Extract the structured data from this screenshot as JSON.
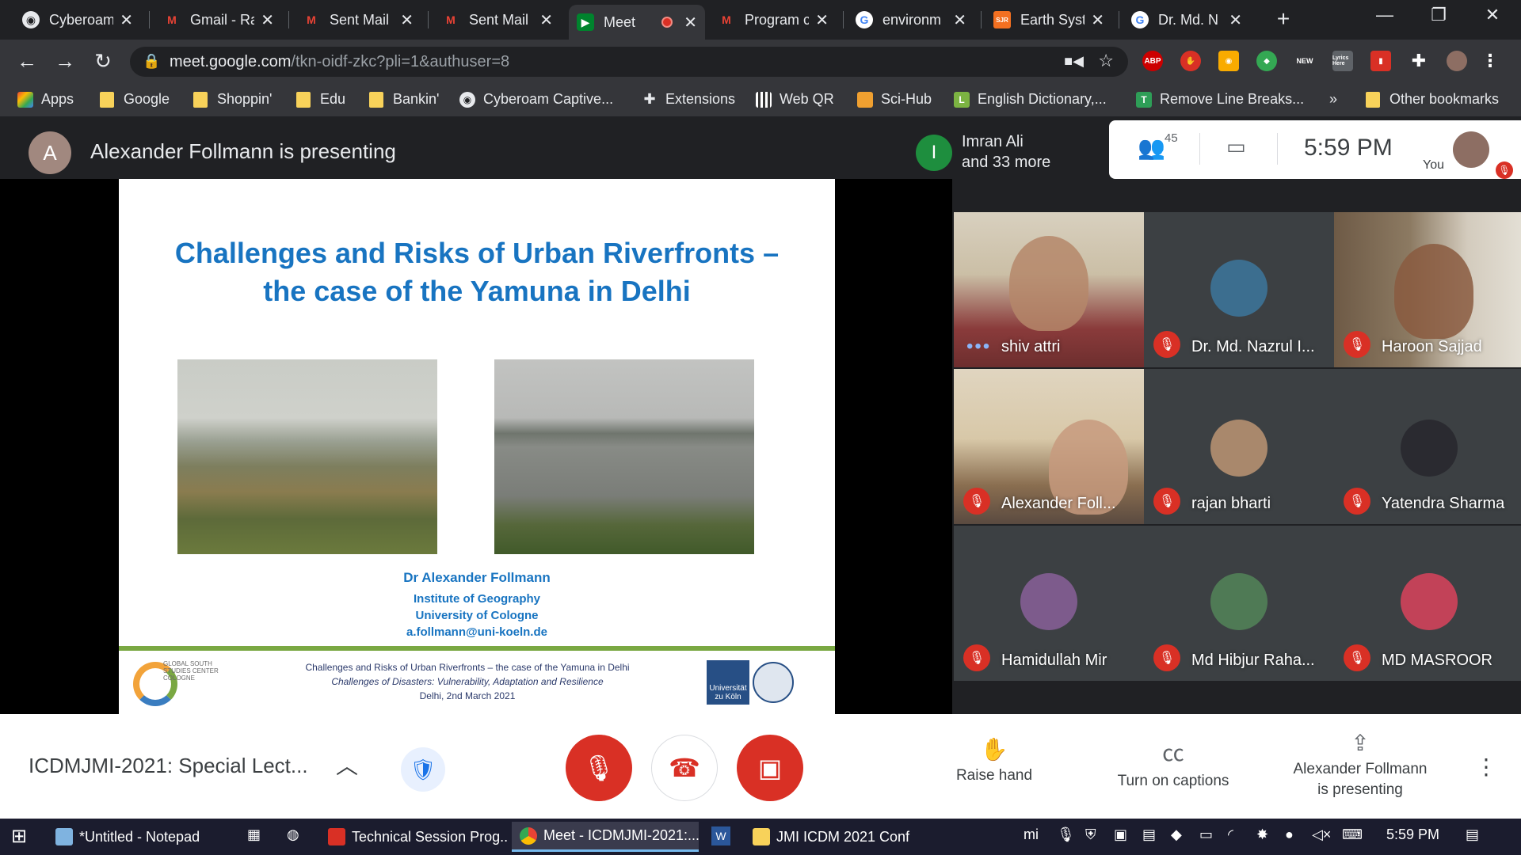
{
  "browser": {
    "tabs": [
      {
        "title": "Cyberoam",
        "icon": "globe-icon",
        "active": false
      },
      {
        "title": "Gmail - Ra",
        "icon": "gmail-icon",
        "active": false
      },
      {
        "title": "Sent Mail",
        "icon": "gmail-icon",
        "active": false
      },
      {
        "title": "Sent Mail",
        "icon": "gmail-icon",
        "active": false
      },
      {
        "title": "Meet",
        "icon": "meet-icon",
        "active": true
      },
      {
        "title": "Program c",
        "icon": "gmail-icon",
        "active": false
      },
      {
        "title": "environm",
        "icon": "google-icon",
        "active": false
      },
      {
        "title": "Earth Syst",
        "icon": "sjr-icon",
        "active": false
      },
      {
        "title": "Dr. Md. N",
        "icon": "google-icon",
        "active": false
      }
    ],
    "new_tab": "+",
    "url_host": "meet.google.com",
    "url_path": "/tkn-oidf-zkc?pli=1&authuser=8",
    "extensions": [
      "ABP",
      "NEW",
      "Lyrics Here"
    ],
    "bookmarks": [
      {
        "label": "Apps",
        "icon": "apps-grid-icon"
      },
      {
        "label": "Google",
        "icon": "folder-icon"
      },
      {
        "label": "Shoppin'",
        "icon": "folder-icon"
      },
      {
        "label": "Edu",
        "icon": "folder-icon"
      },
      {
        "label": "Bankin'",
        "icon": "folder-icon"
      },
      {
        "label": "Cyberoam Captive...",
        "icon": "globe-icon"
      },
      {
        "label": "Extensions",
        "icon": "puzzle-icon"
      },
      {
        "label": "Web QR",
        "icon": "qr-icon"
      },
      {
        "label": "Sci-Hub",
        "icon": "scihub-icon"
      },
      {
        "label": "English Dictionary,...",
        "icon": "dictionary-icon"
      },
      {
        "label": "Remove Line Breaks...",
        "icon": "text-icon"
      }
    ],
    "bookmarks_overflow": "»",
    "other_bookmarks": "Other bookmarks"
  },
  "meet": {
    "presenter_initial": "A",
    "presenting_banner": "Alexander Follmann is presenting",
    "speaker_initial": "I",
    "speaker_name": "Imran Ali",
    "speaker_more": "and 33 more",
    "participant_count": "45",
    "clock": "5:59  PM",
    "you_label": "You",
    "slide": {
      "title_line1": "Challenges and Risks of Urban Riverfronts –",
      "title_line2": "the case of the Yamuna in Delhi",
      "author": "Dr Alexander Follmann",
      "institute": "Institute of Geography",
      "university": "University of Cologne",
      "email": "a.follmann@uni-koeln.de",
      "gs_logo_text": "GLOBAL SOUTH STUDIES CENTER COLOGNE",
      "footer_line1": "Challenges and Risks of Urban Riverfronts – the case of the Yamuna in Delhi",
      "footer_line2": "Challenges of Disasters: Vulnerability, Adaptation and Resilience",
      "footer_line3": "Delhi, 2nd March 2021",
      "uni_logo_text": "Universität zu Köln"
    },
    "participants": [
      {
        "name": "shiv attri",
        "speaking": true,
        "muted": false
      },
      {
        "name": "Dr. Md. Nazrul I...",
        "speaking": false,
        "muted": true
      },
      {
        "name": "Haroon Sajjad",
        "speaking": false,
        "muted": true
      },
      {
        "name": "Alexander Foll...",
        "speaking": false,
        "muted": true
      },
      {
        "name": "rajan bharti",
        "speaking": false,
        "muted": true
      },
      {
        "name": "Yatendra Sharma",
        "speaking": false,
        "muted": true
      },
      {
        "name": "Hamidullah Mir",
        "speaking": false,
        "muted": true
      },
      {
        "name": "Md Hibjur Raha...",
        "speaking": false,
        "muted": true
      },
      {
        "name": "MD MASROOR",
        "speaking": false,
        "muted": true
      }
    ],
    "controls": {
      "meeting_title": "ICDMJMI-2021: Special Lect...",
      "raise_hand": "Raise hand",
      "captions": "Turn on captions",
      "presenting_line1": "Alexander Follmann",
      "presenting_line2": "is presenting"
    }
  },
  "taskbar": {
    "items": [
      {
        "label": "*Untitled - Notepad",
        "active": false
      },
      {
        "label": "Technical Session Prog...",
        "active": false
      },
      {
        "label": "Meet - ICDMJMI-2021:...",
        "active": true
      },
      {
        "label": "JMI ICDM 2021 Conf",
        "active": false
      }
    ],
    "clock": "5:59 PM"
  },
  "colors": {
    "accent_blue": "#1874c1",
    "danger_red": "#d93025",
    "slide_green": "#7aa842"
  }
}
